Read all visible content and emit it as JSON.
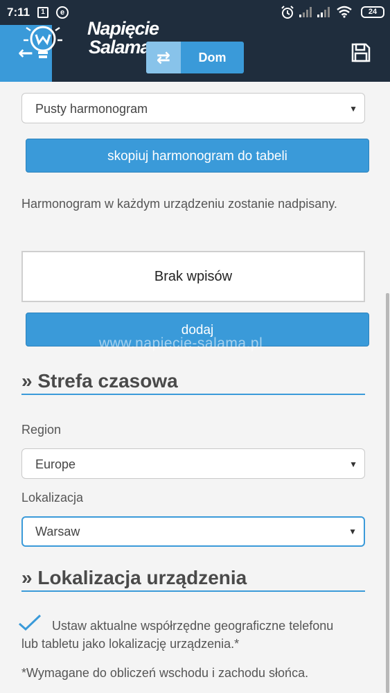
{
  "status_bar": {
    "time": "7:11",
    "notif_box": "1",
    "notif_e": "e",
    "battery": "24"
  },
  "app_bar": {
    "logo_line1": "Napięcie",
    "logo_line2": "Salama",
    "context_label": "Dom"
  },
  "schedule": {
    "select_value": "Pusty harmonogram",
    "copy_button_label": "skopiuj harmonogram do tabeli",
    "overwrite_note": "Harmonogram w każdym urządzeniu zostanie nadpisany.",
    "empty_text": "Brak wpisów",
    "add_button_label": "dodaj",
    "watermark": "www.napiecie-salama.pl"
  },
  "timezone": {
    "title": "» Strefa czasowa",
    "region_label": "Region",
    "region_value": "Europe",
    "location_label": "Lokalizacja",
    "location_value": "Warsaw"
  },
  "device_location": {
    "title": "» Lokalizacja urządzenia",
    "checkbox_label": "Ustaw aktualne współrzędne geograficzne telefonu lub tabletu jako lokalizację urządzenia.*",
    "footnote": "*Wymagane do obliczeń wschodu i zachodu słońca."
  },
  "colors": {
    "header_bg": "#1f2d3d",
    "accent": "#3a9ad9",
    "page_bg": "#f4f4f4"
  }
}
